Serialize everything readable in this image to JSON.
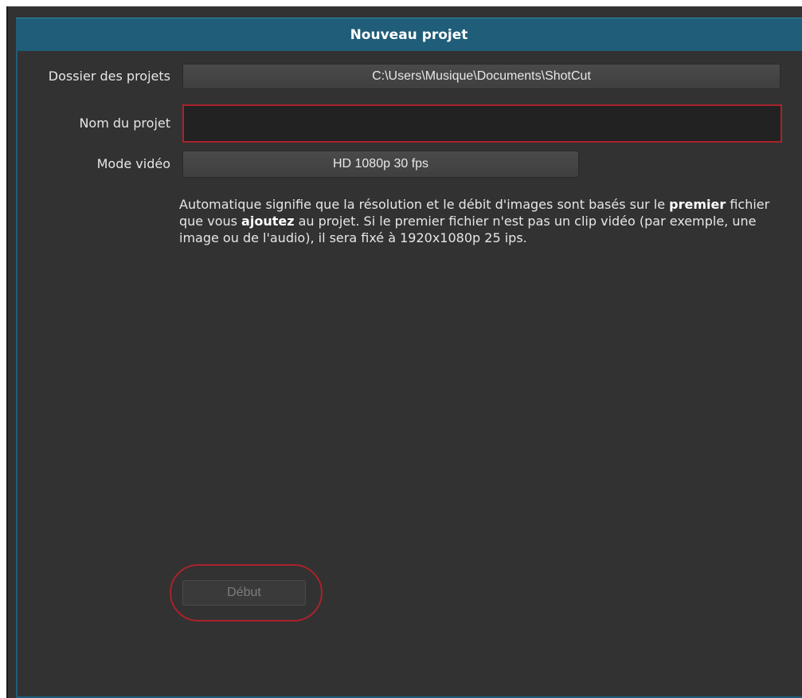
{
  "dialog": {
    "title": "Nouveau projet"
  },
  "project_folder": {
    "label": "Dossier des projets",
    "value": "C:\\Users\\Musique\\Documents\\ShotCut"
  },
  "project_name": {
    "label": "Nom du projet",
    "value": "",
    "placeholder": ""
  },
  "video_mode": {
    "label": "Mode vidéo",
    "value": "HD 1080p 30 fps"
  },
  "description": {
    "part1": "Automatique signifie que la résolution et le débit d'images sont basés sur le ",
    "bold1": "premier",
    "part2": " fichier que vous ",
    "bold2": "ajoutez",
    "part3": " au projet. Si le premier fichier n'est pas un clip vidéo (par exemple, une image ou de l'audio), il sera fixé à 1920x1080p 25 ips."
  },
  "start_button": {
    "label": "Début",
    "enabled": false
  },
  "colors": {
    "title_bar": "#1f5d78",
    "panel_background": "#323232",
    "highlight_red": "#a8232a"
  }
}
